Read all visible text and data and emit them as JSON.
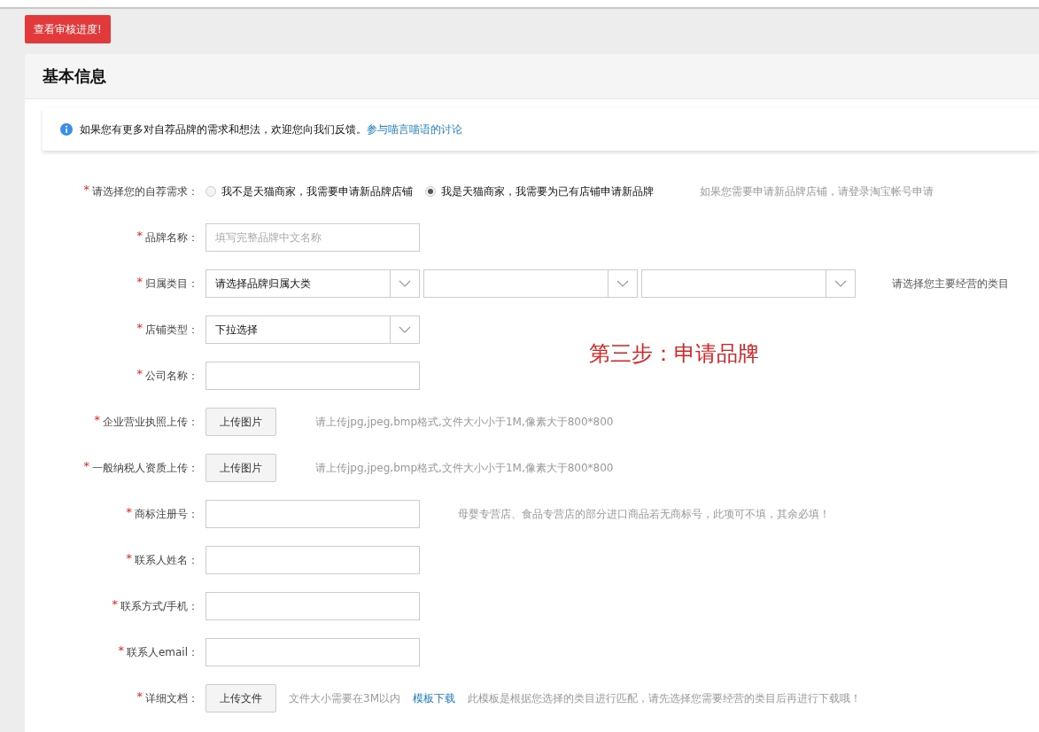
{
  "top_button": "查看审核进度!",
  "section_title": "基本信息",
  "notice": {
    "text": "如果您有更多对自荐品牌的需求和想法，欢迎您向我们反馈。",
    "link": "参与喵言喵语的讨论"
  },
  "annotation": "第三步：申请品牌",
  "rows": [
    {
      "kind": "radio",
      "mark": "*",
      "label": "请选择您的自荐需求：",
      "options": [
        {
          "label": "我不是天猫商家，我需要申请新品牌店铺",
          "selected": false
        },
        {
          "label": "我是天猫商家，我需要为已有店铺申请新品牌",
          "selected": true
        }
      ],
      "hint": "如果您需要申请新品牌店铺，请登录淘宝帐号申请"
    },
    {
      "kind": "text",
      "mark": "*",
      "label": "品牌名称：",
      "placeholder": "填写完整品牌中文名称"
    },
    {
      "kind": "select",
      "mark": "*",
      "label": "归属类目：",
      "selects": [
        {
          "kind": "chosen",
          "value": "请选择品牌归属大类"
        },
        {
          "kind": "blank"
        },
        {
          "kind": "blank"
        }
      ],
      "hint": "请选择您主要经营的类目"
    },
    {
      "kind": "select",
      "mark": "*",
      "label": "店铺类型：",
      "selects": [
        {
          "kind": "chosen",
          "value": "下拉选择"
        }
      ]
    },
    {
      "kind": "text",
      "mark": "*",
      "label": "公司名称："
    },
    {
      "kind": "upload",
      "mark": "*",
      "label": "企业营业执照上传：",
      "button": "上传图片",
      "hint": "请上传jpg,jpeg,bmp格式,文件大小小于1M,像素大于800*800"
    },
    {
      "kind": "upload",
      "mark": "*",
      "label": "一般纳税人资质上传：",
      "button": "上传图片",
      "hint": "请上传jpg,jpeg,bmp格式,文件大小小于1M,像素大于800*800"
    },
    {
      "kind": "text",
      "mark": "*",
      "label": "商标注册号：",
      "hint": "母婴专营店、食品专营店的部分进口商品若无商标号，此项可不填，其余必填！"
    },
    {
      "kind": "text",
      "mark": "*",
      "label": "联系人姓名："
    },
    {
      "kind": "text",
      "mark": "*",
      "label": "联系方式/手机："
    },
    {
      "kind": "text",
      "mark": "*",
      "label": "联系人email："
    },
    {
      "kind": "upload",
      "mark": "*",
      "label": "详细文档：",
      "button": "上传文件",
      "notes": [
        {
          "kind": "text",
          "text": "文件大小需要在3M以内"
        },
        {
          "kind": "link",
          "text": "模板下载"
        },
        {
          "kind": "text",
          "text": "此模板是根据您选择的类目进行匹配，请先选择您需要经营的类目后再进行下载哦！"
        }
      ]
    }
  ]
}
